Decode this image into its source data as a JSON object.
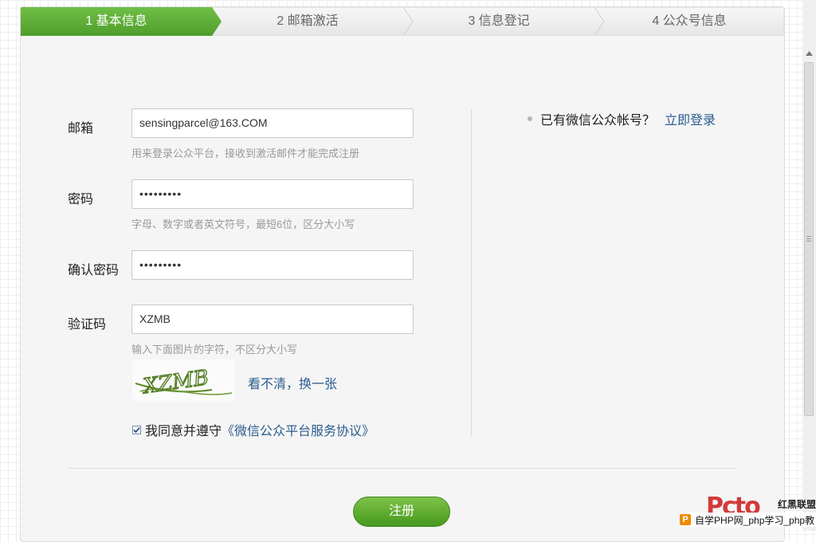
{
  "steps": [
    {
      "label": "1 基本信息",
      "active": true
    },
    {
      "label": "2 邮箱激活",
      "active": false
    },
    {
      "label": "3 信息登记",
      "active": false
    },
    {
      "label": "4 公众号信息",
      "active": false
    }
  ],
  "form": {
    "email": {
      "label": "邮箱",
      "value": "sensingparcel@163.COM",
      "hint": "用来登录公众平台，接收到激活邮件才能完成注册"
    },
    "password": {
      "label": "密码",
      "value": "•••••••••",
      "hint": "字母、数字或者英文符号，最短6位，区分大小写"
    },
    "confirm_password": {
      "label": "确认密码",
      "value": "•••••••••"
    },
    "captcha": {
      "label": "验证码",
      "value": "XZMB",
      "hint": "输入下面图片的字符，不区分大小写",
      "image_text": "XZMB",
      "refresh_label": "看不清，换一张"
    },
    "agreement": {
      "prefix": "我同意并遵守",
      "link": "《微信公众平台服务协议》",
      "checked": true
    }
  },
  "side": {
    "tip": "已有微信公众帐号？",
    "login_link": "立即登录"
  },
  "register_button": "注册",
  "watermark": {
    "logo": "Pcto",
    "alliance": "红黑联盟",
    "bar_text": "自学PHP网_php学习_php教"
  },
  "colors": {
    "active_step": "#5fae38",
    "link": "#2b5c8f",
    "button": "#5aa82a"
  }
}
